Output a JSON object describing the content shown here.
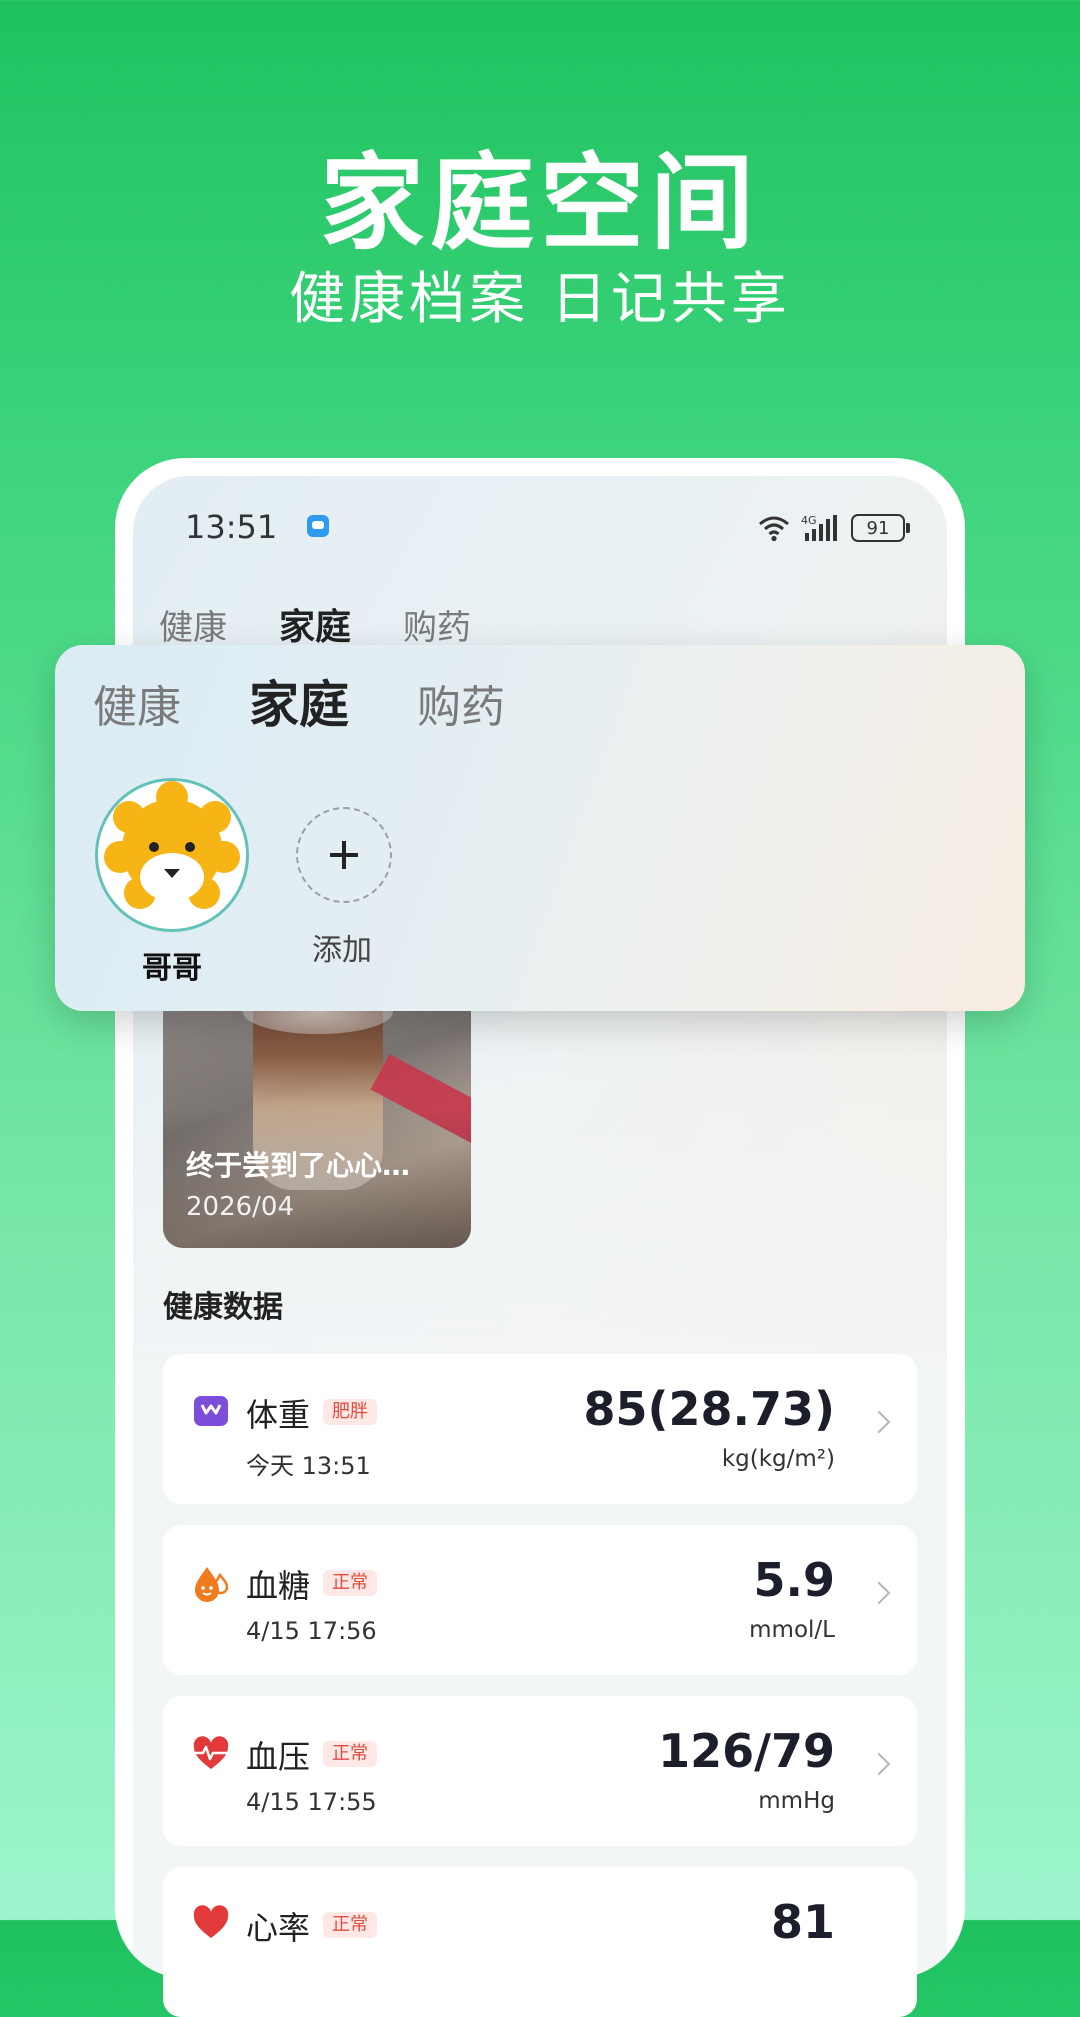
{
  "hero": {
    "title": "家庭空间",
    "subtitle": "健康档案 日记共享"
  },
  "status_bar": {
    "time": "13:51",
    "network": "4G",
    "battery": "91"
  },
  "top_tabs": [
    {
      "label": "健康",
      "active": false
    },
    {
      "label": "家庭",
      "active": true
    },
    {
      "label": "购药",
      "active": false
    }
  ],
  "family": {
    "members": [
      {
        "name": "哥哥"
      }
    ],
    "add_label": "添加",
    "add_symbol": "+"
  },
  "diary": {
    "title": "终于尝到了心心…",
    "date": "2026/04"
  },
  "health_section": {
    "title": "健康数据"
  },
  "health_items": [
    {
      "name": "体重",
      "badge": "肥胖",
      "time": "今天 13:51",
      "value": "85(28.73)",
      "unit": "kg(kg/m²)",
      "icon": "scale-icon",
      "color": "#7b4dd8"
    },
    {
      "name": "血糖",
      "badge": "正常",
      "time": "4/15 17:56",
      "value": "5.9",
      "unit": "mmol/L",
      "icon": "blood-drop-icon",
      "color": "#f07b1d"
    },
    {
      "name": "血压",
      "badge": "正常",
      "time": "4/15 17:55",
      "value": "126/79",
      "unit": "mmHg",
      "icon": "heart-pulse-icon",
      "color": "#e23a3a"
    },
    {
      "name": "心率",
      "badge": "正常",
      "value": "81",
      "icon": "heart-icon",
      "color": "#e23a3a"
    }
  ]
}
